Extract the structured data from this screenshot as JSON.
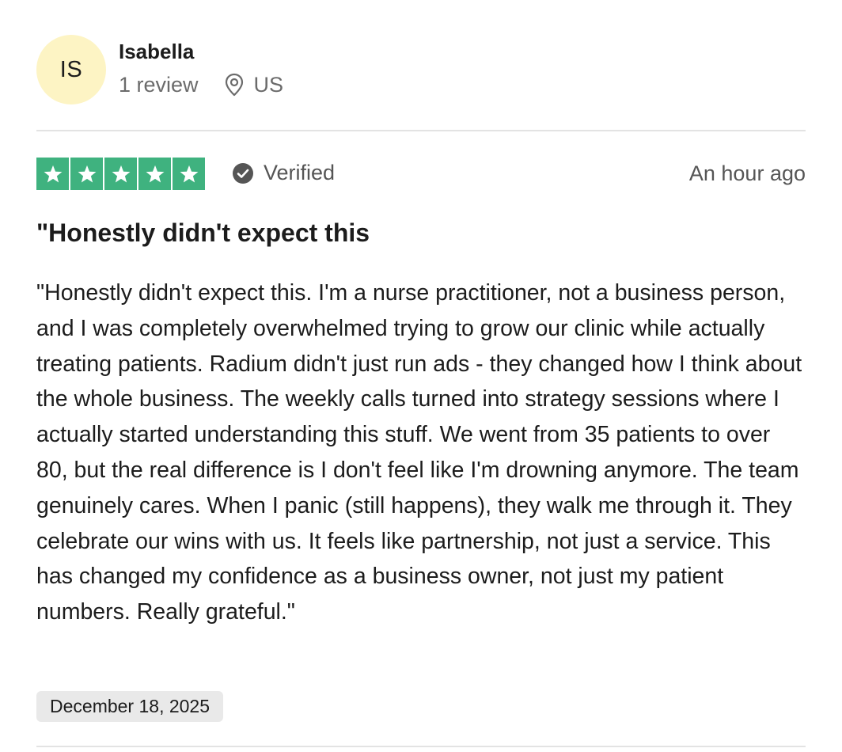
{
  "reviewer": {
    "initials": "IS",
    "name": "Isabella",
    "review_count": "1 review",
    "country": "US",
    "avatar_color": "#fdf4c4"
  },
  "rating": {
    "stars": 5,
    "max_stars": 5,
    "star_color": "#3fb27f",
    "verified_label": "Verified",
    "time_ago": "An hour ago"
  },
  "review": {
    "title": "\"Honestly didn't expect this",
    "body": "\"Honestly didn't expect this. I'm a nurse practitioner, not a business person, and I was completely overwhelmed trying to grow our clinic while actually treating patients. Radium didn't just run ads - they changed how I think about the whole business. The weekly calls turned into strategy sessions where I actually started understanding this stuff. We went from 35 patients to over 80, but the real difference is I don't feel like I'm drowning anymore. The team genuinely cares. When I panic (still happens), they walk me through it. They celebrate our wins with us. It feels like partnership, not just a service. This has changed my confidence as a business owner, not just my patient numbers. Really grateful.\"",
    "date": "December 18, 2025"
  },
  "icons": {
    "location": "location-pin-icon",
    "verified": "check-circle-icon",
    "star": "star-icon"
  }
}
